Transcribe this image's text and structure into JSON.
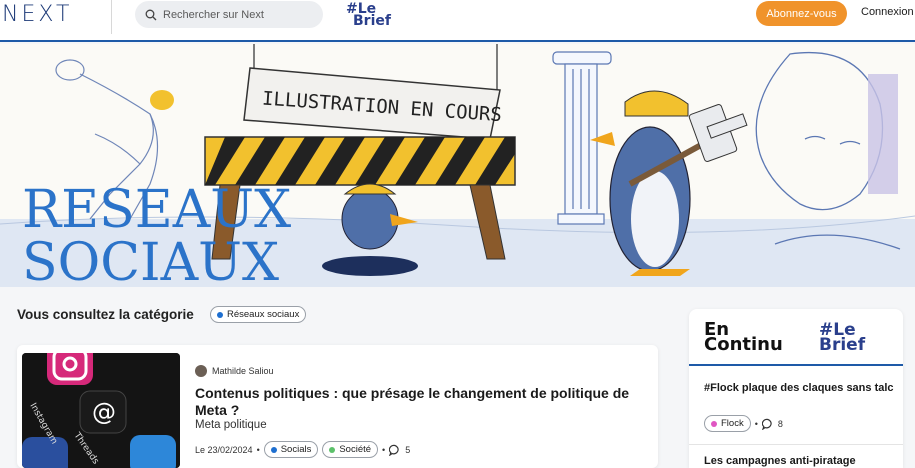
{
  "header": {
    "logo": "NEXT",
    "search_placeholder": "Rechercher sur Next",
    "brief_line1": "#Le",
    "brief_line2": "Brief",
    "subscribe_label": "Abonnez-vous",
    "login_label": "Connexion"
  },
  "banner": {
    "sign_text": "ILLUSTRATION EN COURS",
    "title_line1": "RESEAUX",
    "title_line2": "SOCIAUX"
  },
  "category": {
    "prefix": "Vous consultez la catégorie",
    "name": "Réseaux sociaux",
    "dot_color": "#1e6fd0"
  },
  "article": {
    "author": "Mathilde Saliou",
    "title": "Contenus politiques : que présage le changement de politique de Meta ?",
    "subtitle": "Meta politique",
    "date": "Le 23/02/2024",
    "tags": [
      {
        "label": "Socials",
        "color": "#1e6fd0"
      },
      {
        "label": "Société",
        "color": "#5cc16a"
      }
    ],
    "comments": "5",
    "thumb_texts": [
      "Instagram",
      "Threads"
    ]
  },
  "sidebar": {
    "heading_line1": "En",
    "heading_line2": "Continu",
    "brief_line1": "#Le",
    "brief_line2": "Brief",
    "news": [
      {
        "title": "#Flock plaque des claques sans talc",
        "tag": "Flock",
        "tag_color": "#e056c2",
        "comments": "8"
      },
      {
        "title": "Les campagnes anti-piratage"
      }
    ]
  }
}
